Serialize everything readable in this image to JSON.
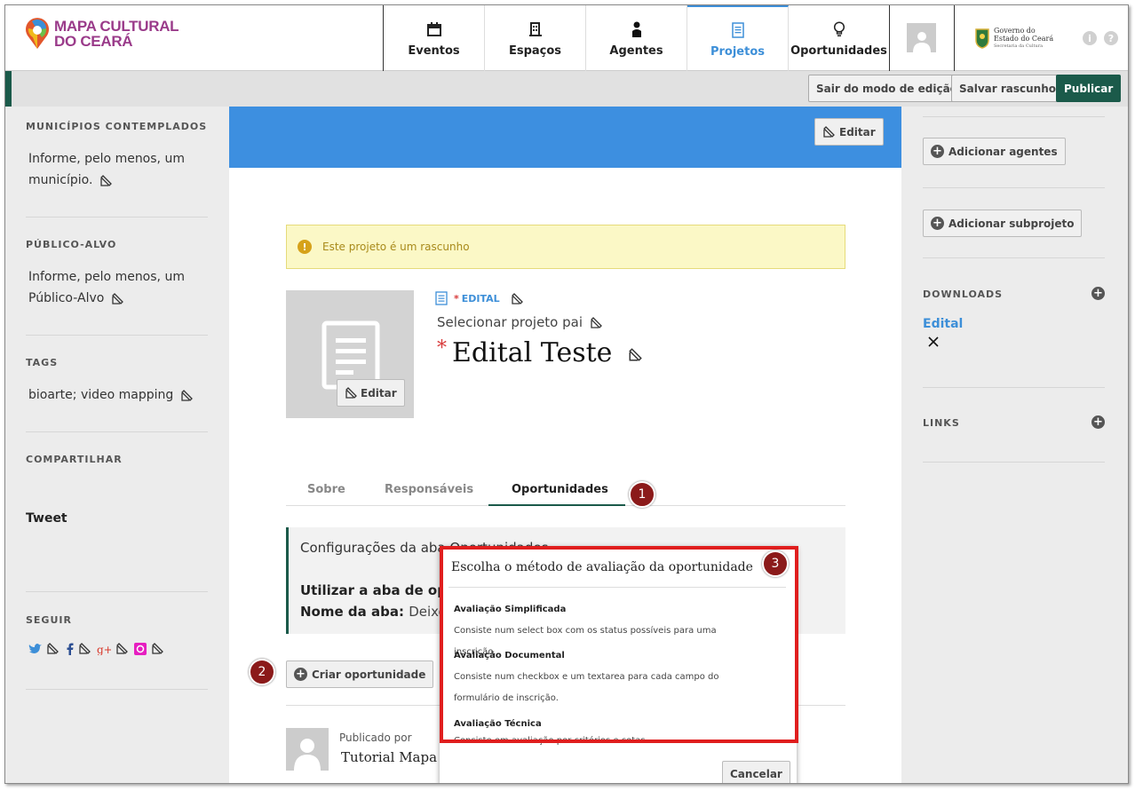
{
  "header": {
    "logo_line1": "MAPA CULTURAL",
    "logo_line2": "DO CEARÁ",
    "nav": [
      {
        "label": "Eventos",
        "icon": "calendar-icon"
      },
      {
        "label": "Espaços",
        "icon": "building-icon"
      },
      {
        "label": "Agentes",
        "icon": "person-icon"
      },
      {
        "label": "Projetos",
        "icon": "document-icon",
        "active": true
      },
      {
        "label": "Oportunidades",
        "icon": "lightbulb-icon"
      }
    ],
    "gov_line1": "Governo do",
    "gov_line2": "Estado do Ceará",
    "gov_line3": "Secretaria da Cultura",
    "info_glyph": "i",
    "help_glyph": "?"
  },
  "editbar": {
    "exit_label": "Sair do modo de edição",
    "save_draft_label": "Salvar rascunho",
    "publish_label": "Publicar"
  },
  "left": {
    "municipios_title": "MUNICÍPIOS CONTEMPLADOS",
    "municipios_value": "Informe, pelo menos, um município.",
    "publico_title": "PÚBLICO-ALVO",
    "publico_value": "Informe, pelo menos, um Público-Alvo",
    "tags_title": "TAGS",
    "tags_value": "bioarte; video mapping",
    "compartilhar_title": "COMPARTILHAR",
    "tweet_label": "Tweet",
    "seguir_title": "SEGUIR"
  },
  "main": {
    "cover_edit_label": "Editar",
    "draft_notice": "Este projeto é um rascunho",
    "thumb_edit_label": "Editar",
    "type_asterisk": "*",
    "type_label": "EDITAL",
    "parent_label": "Selecionar projeto pai",
    "title_asterisk": "*",
    "title": "Edital Teste",
    "tabs": [
      "Sobre",
      "Responsáveis",
      "Oportunidades"
    ],
    "cfg_heading": "Configurações da aba Oportunidades",
    "cfg_use_label": "Utilizar a aba de op",
    "cfg_name_label": "Nome da aba:",
    "cfg_name_value": "Deixe",
    "create_label": "Criar oportunidade",
    "published_by": "Publicado por",
    "author": "Tutorial Mapa"
  },
  "badges": [
    "1",
    "2",
    "3"
  ],
  "right": {
    "add_agents_label": "Adicionar agentes",
    "add_subproject_label": "Adicionar subprojeto",
    "downloads_title": "DOWNLOADS",
    "download_item": "Edital",
    "links_title": "LINKS"
  },
  "modal": {
    "title": "Escolha o método de avaliação da oportunidade",
    "options": [
      {
        "title": "Avaliação Simplificada",
        "desc": "Consiste num select box com os status possíveis para uma inscrição."
      },
      {
        "title": "Avaliação Documental",
        "desc": "Consiste num checkbox e um textarea para cada campo do formulário de inscrição."
      },
      {
        "title": "Avaliação Técnica",
        "desc": "Consiste em avaliação por critérios e cotas."
      }
    ],
    "cancel_label": "Cancelar"
  },
  "colors": {
    "accent_blue": "#3d8fe0",
    "brand_green": "#1b5a4a",
    "highlight_red": "#e01e1e",
    "badge_red": "#8b1a1a"
  }
}
